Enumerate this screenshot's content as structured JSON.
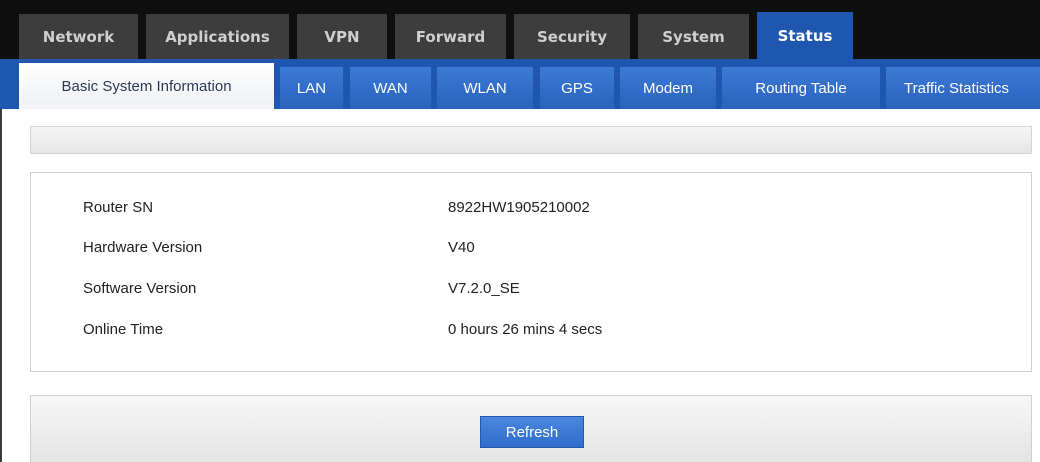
{
  "top_tabs": [
    {
      "label": "Network"
    },
    {
      "label": "Applications"
    },
    {
      "label": "VPN"
    },
    {
      "label": "Forward"
    },
    {
      "label": "Security"
    },
    {
      "label": "System"
    },
    {
      "label": "Status",
      "active": true
    }
  ],
  "sub_tabs": [
    {
      "label": "Basic System Information",
      "active": true
    },
    {
      "label": "LAN"
    },
    {
      "label": "WAN"
    },
    {
      "label": "WLAN"
    },
    {
      "label": "GPS"
    },
    {
      "label": "Modem"
    },
    {
      "label": "Routing Table"
    },
    {
      "label": "Traffic Statistics"
    }
  ],
  "info": {
    "rows": [
      {
        "label": "Router SN",
        "value": "8922HW1905210002"
      },
      {
        "label": "Hardware Version",
        "value": "V40"
      },
      {
        "label": "Software Version",
        "value": "V7.2.0_SE"
      },
      {
        "label": "Online Time",
        "value": "0 hours 26 mins 4 secs"
      }
    ]
  },
  "actions": {
    "refresh_label": "Refresh"
  },
  "colors": {
    "topbar_bg": "#0f0f0f",
    "tab_bg": "#3d3d3d",
    "accent_blue": "#1f56b0",
    "subtab_blue": "#2f6ccc"
  }
}
